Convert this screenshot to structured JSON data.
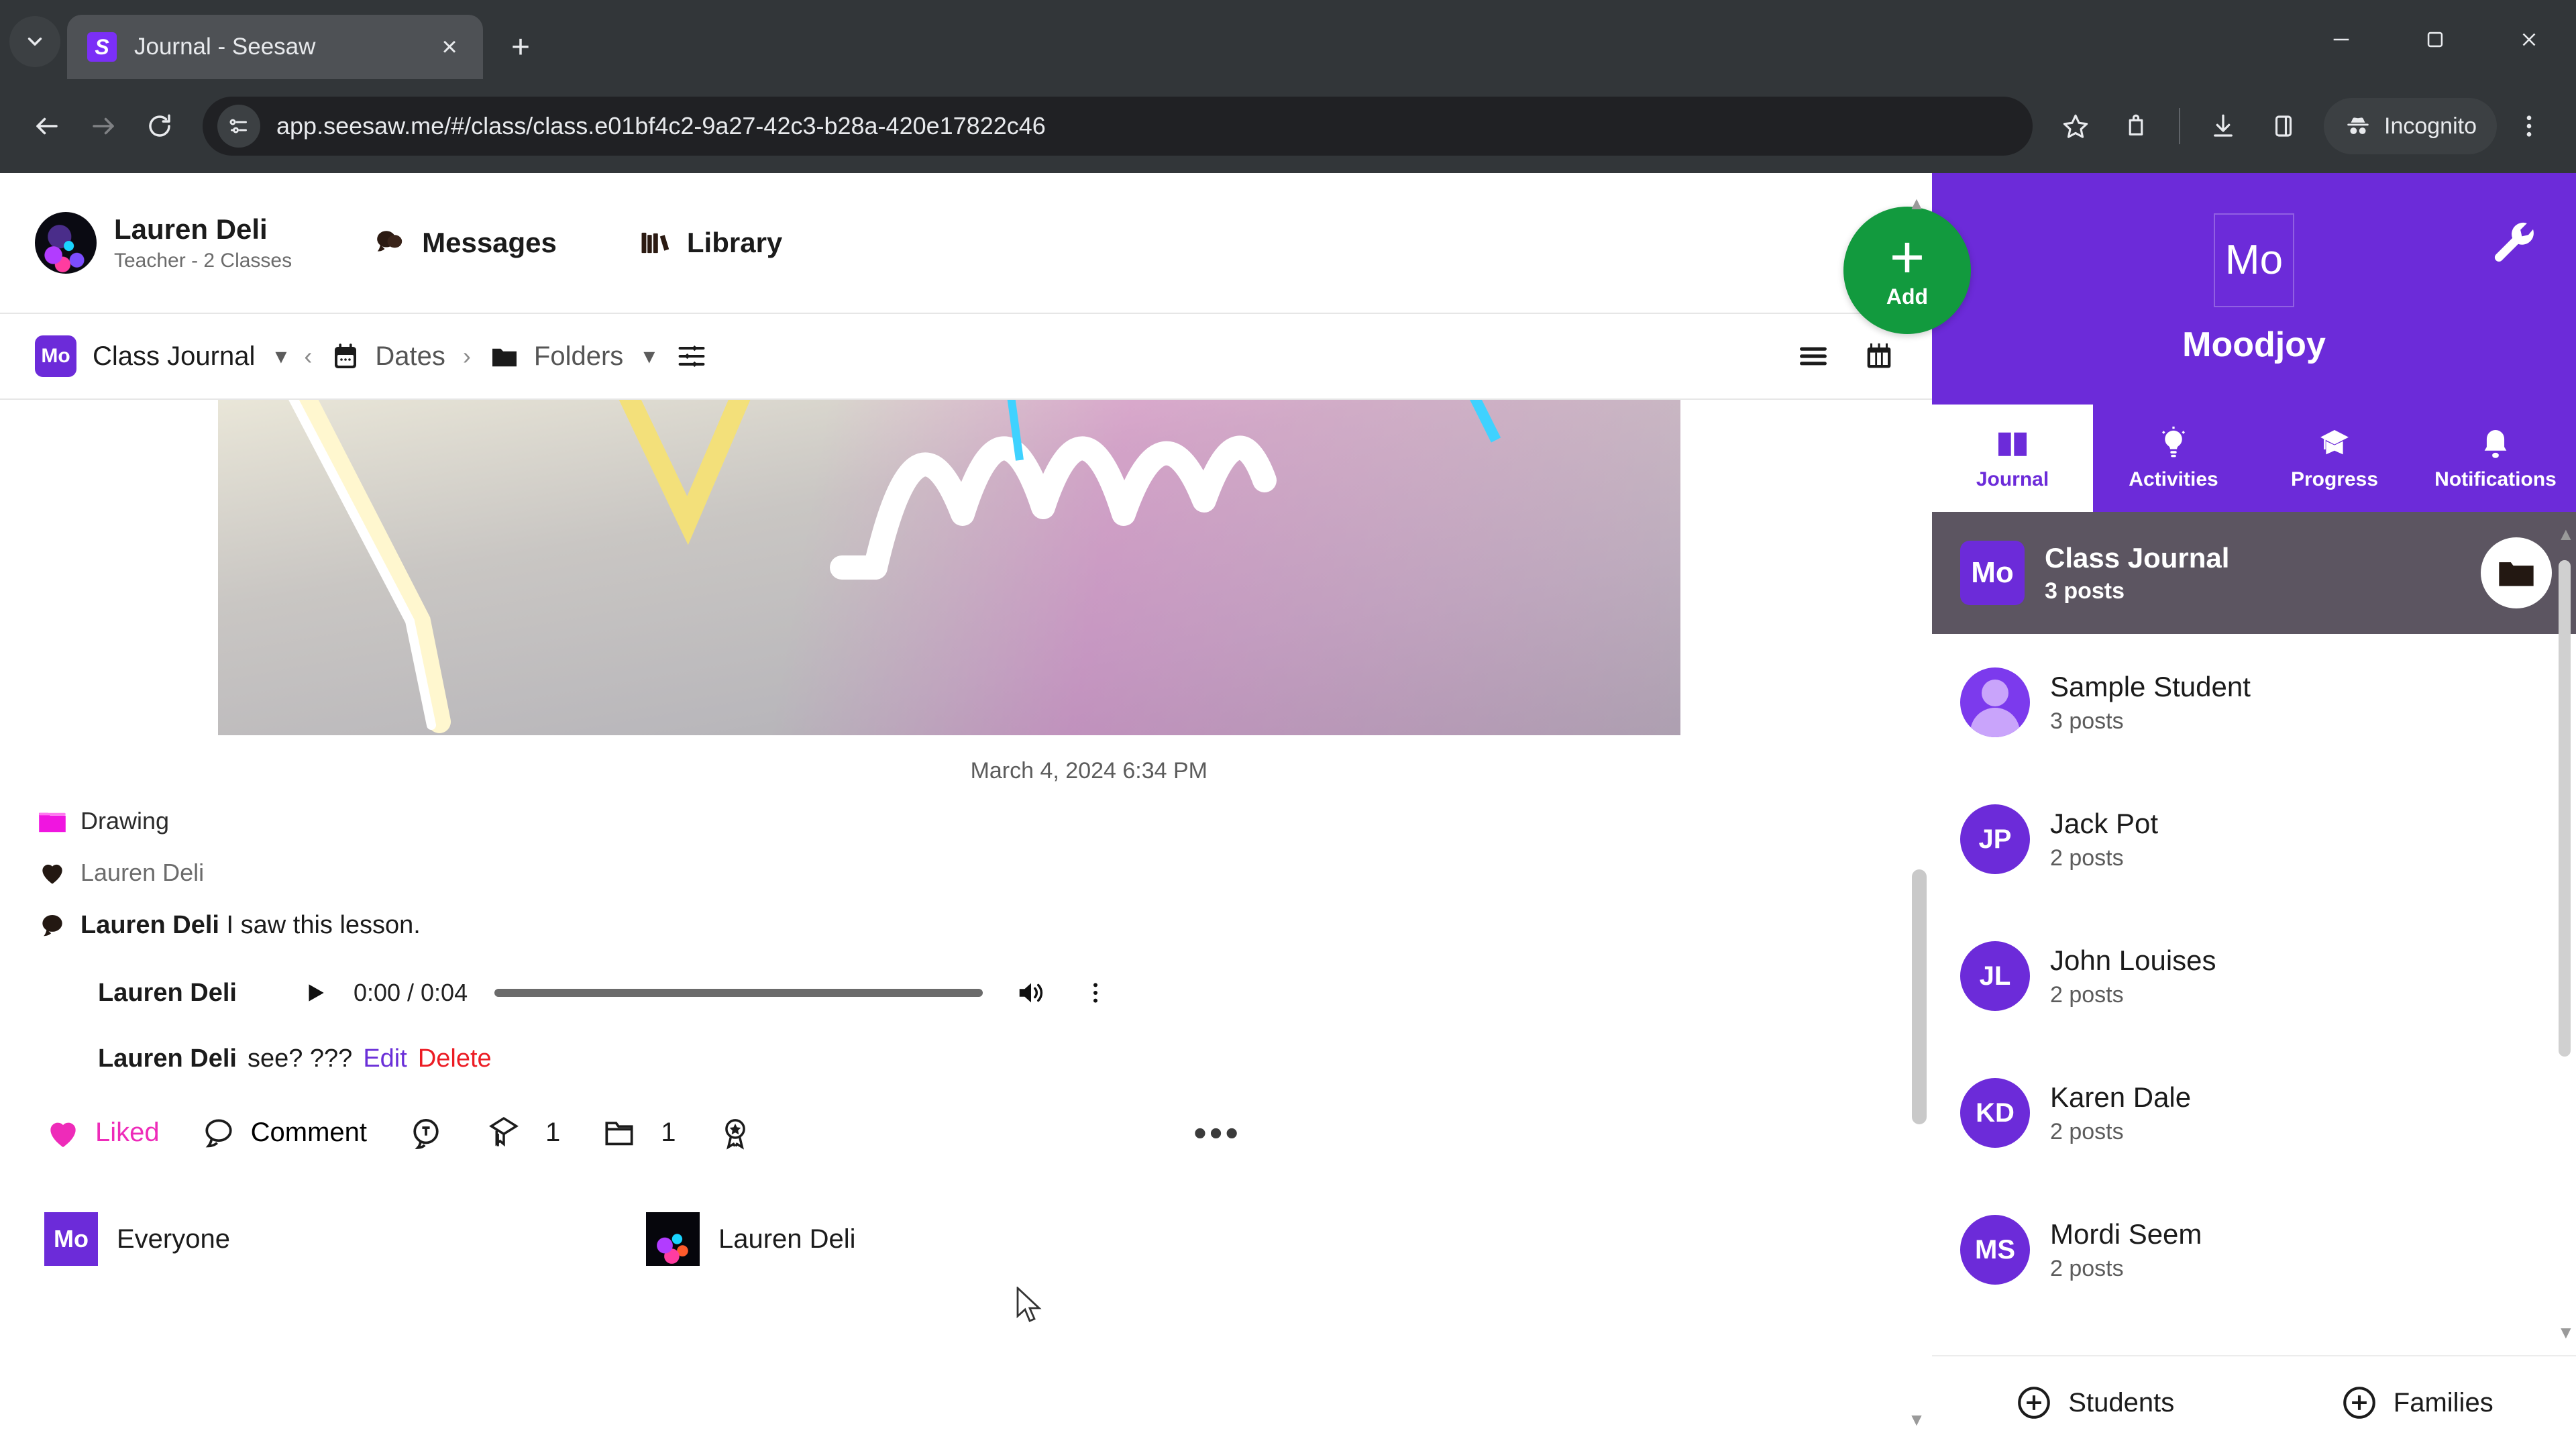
{
  "browser": {
    "tab": {
      "title": "Journal - Seesaw",
      "favicon_letter": "S",
      "close_label": "×"
    },
    "new_tab_label": "+",
    "url": "app.seesaw.me/#/class/class.e01bf4c2-9a27-42c3-b28a-420e17822c46",
    "profile_label": "Incognito",
    "accent": "#7b2ff7"
  },
  "header": {
    "user_name": "Lauren Deli",
    "user_role": "Teacher - 2 Classes",
    "messages_label": "Messages",
    "library_label": "Library"
  },
  "navbar": {
    "class_chip": "Mo",
    "class_label": "Class Journal",
    "dates_label": "Dates",
    "folders_label": "Folders"
  },
  "post": {
    "date": "March 4, 2024 6:34 PM",
    "folder_tag": "Drawing",
    "folder_color": "#f015e0",
    "liked_by": "Lauren Deli",
    "comment_author": "Lauren Deli",
    "comment_body": "I saw this lesson.",
    "audio_author": "Lauren Deli",
    "audio_time": "0:00 / 0:04",
    "edit_author": "Lauren Deli",
    "edit_body": "see? ???",
    "edit_label": "Edit",
    "delete_label": "Delete",
    "liked_label": "Liked",
    "comment_label": "Comment",
    "skill_count": "1",
    "folder_count": "1",
    "more_label": "•••",
    "tags": [
      {
        "initials": "Mo",
        "label": "Everyone",
        "type": "square"
      },
      {
        "initials": "",
        "label": "Lauren Deli",
        "type": "photo"
      }
    ]
  },
  "sidebar": {
    "class_initials": "Mo",
    "class_name": "Moodjoy",
    "tabs": [
      {
        "label": "Journal",
        "icon": "book-icon",
        "active": true
      },
      {
        "label": "Activities",
        "icon": "lightbulb-icon",
        "active": false
      },
      {
        "label": "Progress",
        "icon": "graduation-icon",
        "active": false
      },
      {
        "label": "Notifications",
        "icon": "bell-icon",
        "active": false
      }
    ],
    "class_row": {
      "initials": "Mo",
      "name": "Class Journal",
      "posts": "3 posts"
    },
    "students": [
      {
        "initials": "",
        "name": "Sample Student",
        "posts": "3 posts",
        "generic": true
      },
      {
        "initials": "JP",
        "name": "Jack Pot",
        "posts": "2 posts",
        "generic": false
      },
      {
        "initials": "JL",
        "name": "John Louises",
        "posts": "2 posts",
        "generic": false
      },
      {
        "initials": "KD",
        "name": "Karen Dale",
        "posts": "2 posts",
        "generic": false
      },
      {
        "initials": "MS",
        "name": "Mordi Seem",
        "posts": "2 posts",
        "generic": false
      }
    ],
    "footer": {
      "students_label": "Students",
      "families_label": "Families"
    },
    "add_label": "Add",
    "brand_purple": "#6c2bd9",
    "add_green": "#129a3e"
  }
}
